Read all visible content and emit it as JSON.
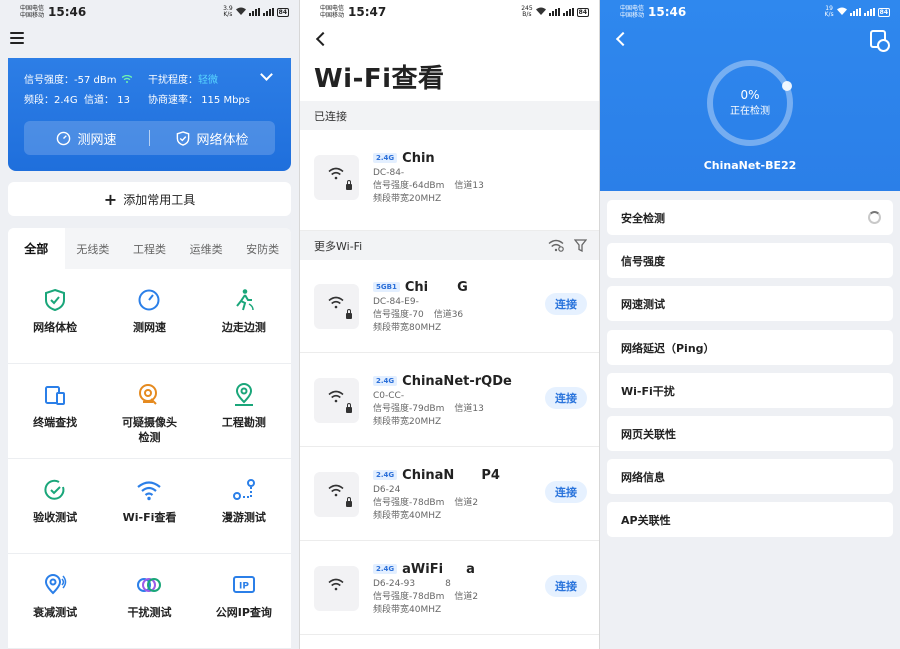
{
  "status": {
    "s1": {
      "carrier1": "中国电信",
      "carrier2": "中国移动",
      "time": "15:46",
      "speed_val": "3.9",
      "speed_unit": "K/s",
      "battery": "84"
    },
    "s2": {
      "carrier1": "中国电信",
      "carrier2": "中国移动",
      "time": "15:47",
      "speed_val": "245",
      "speed_unit": "B/s",
      "battery": "84"
    },
    "s3": {
      "carrier1": "中国电信",
      "carrier2": "中国移动",
      "time": "15:46",
      "speed_val": "19",
      "speed_unit": "K/s",
      "battery": "84"
    }
  },
  "home": {
    "signal_label": "信号强度：",
    "signal_value": "-57 dBm",
    "interference_label": "干扰程度：",
    "interference_value": "轻微",
    "band_label": "频段：2.4G",
    "channel_label": "信道：",
    "channel_value": "13",
    "rate_label": "协商速率：",
    "rate_value": "115 Mbps",
    "speed_test_btn": "测网速",
    "network_check_btn": "网络体检",
    "add_tools": "添加常用工具",
    "tabs": [
      "全部",
      "无线类",
      "工程类",
      "运维类",
      "安防类"
    ],
    "tools": [
      {
        "label": "网络体检",
        "icon": "shield-check-icon"
      },
      {
        "label": "测网速",
        "icon": "speedometer-icon"
      },
      {
        "label": "边走边测",
        "icon": "walking-person-icon"
      },
      {
        "label": "终端查找",
        "icon": "device-search-icon"
      },
      {
        "label": "可疑摄像头\n检测",
        "icon": "camera-detect-icon"
      },
      {
        "label": "工程勘测",
        "icon": "map-pin-icon"
      },
      {
        "label": "验收测试",
        "icon": "check-circle-icon"
      },
      {
        "label": "Wi-Fi查看",
        "icon": "wifi-icon"
      },
      {
        "label": "漫游测试",
        "icon": "roaming-icon"
      },
      {
        "label": "衰减测试",
        "icon": "attenuation-pin-icon"
      },
      {
        "label": "干扰测试",
        "icon": "interference-rings-icon"
      },
      {
        "label": "公网IP查询",
        "icon": "ip-icon"
      }
    ]
  },
  "wifi_view": {
    "title": "Wi-Fi查看",
    "connected_header": "已连接",
    "more_header": "更多Wi-Fi",
    "connected": {
      "band": "2.4G",
      "ssid": "Chin",
      "mac": "DC-84-",
      "signal": "信号强度-64dBm",
      "channel": "信道13",
      "bandwidth": "频段带宽20MHZ"
    },
    "networks": [
      {
        "band": "5GB1",
        "ssid": "Chi",
        "ssid_tail": "G",
        "mac": "DC-84-E9-",
        "mac_tail": "",
        "signal": "信号强度-70",
        "signal_tail": "",
        "channel": "信道36",
        "bandwidth": "频段带宽80MHZ",
        "connect": "连接"
      },
      {
        "band": "2.4G",
        "ssid": "ChinaNet-rQDe",
        "ssid_tail": "",
        "mac": "C0-CC-",
        "mac_tail": "",
        "signal": "信号强度-79dBm",
        "signal_tail": "",
        "channel": "信道13",
        "bandwidth": "频段带宽20MHZ",
        "connect": "连接"
      },
      {
        "band": "2.4G",
        "ssid": "ChinaN",
        "ssid_tail": "P4",
        "mac": "D6-24",
        "mac_tail": "",
        "signal": "信号强度-78dBm",
        "signal_tail": "",
        "channel": "信道2",
        "bandwidth": "频段带宽40MHZ",
        "connect": "连接"
      },
      {
        "band": "2.4G",
        "ssid": "aWiFi",
        "ssid_tail": "a",
        "mac": "D6-24-93",
        "mac_tail": "8",
        "signal": "信号强度-78dBm",
        "signal_tail": "",
        "channel": "信道2",
        "bandwidth": "频段带宽40MHZ",
        "connect": "连接"
      }
    ]
  },
  "check": {
    "percent": "0%",
    "progress": 0,
    "status": "正在检测",
    "network_name": "ChinaNet-BE22",
    "items": [
      "安全检测",
      "信号强度",
      "网速测试",
      "网络延迟（Ping）",
      "Wi-Fi干扰",
      "网页关联性",
      "网络信息",
      "AP关联性"
    ]
  },
  "colors": {
    "primary": "#2b7fe8",
    "green": "#1aa67a",
    "orange": "#e58a1f",
    "connect_bg": "#e6f1ff"
  }
}
